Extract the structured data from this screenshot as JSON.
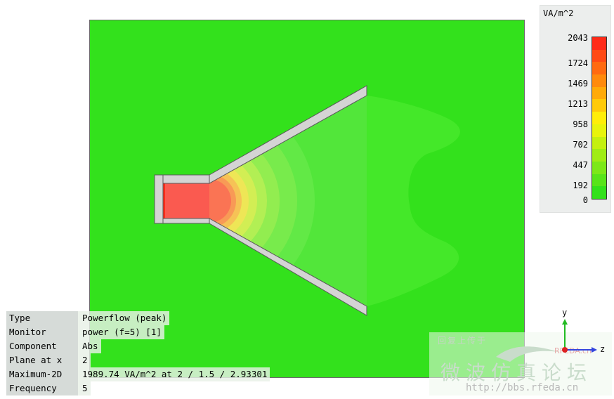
{
  "legend": {
    "unit": "VA/m^2",
    "ticks": [
      "2043",
      "1724",
      "1469",
      "1213",
      "958",
      "702",
      "447",
      "192",
      "0"
    ],
    "colors": [
      "#ff2a18",
      "#ff4a14",
      "#ff6a10",
      "#ff8a0c",
      "#ffaa08",
      "#ffca08",
      "#ffee08",
      "#e8f40c",
      "#c4f010",
      "#a0ec14",
      "#7ce818",
      "#58e41a",
      "#33e11c"
    ]
  },
  "info": [
    {
      "key": "Type",
      "value": "Powerflow (peak)"
    },
    {
      "key": "Monitor",
      "value": "power (f=5) [1]"
    },
    {
      "key": "Component",
      "value": "Abs"
    },
    {
      "key": "Plane at x",
      "value": "2"
    },
    {
      "key": "Maximum-2D",
      "value": "1989.74 VA/m^2 at 2 / 1.5 / 2.93301"
    },
    {
      "key": "Frequency",
      "value": "5"
    }
  ],
  "axes": {
    "y_label": "y",
    "z_label": "z"
  },
  "watermark": {
    "small_text": "回复上传于",
    "brand": "RFEDA.cn",
    "chinese": "微波仿真论坛",
    "url": "http://bbs.rfeda.cn"
  },
  "colors": {
    "background_field": "#33e11c",
    "horn_wall": "#d4d4d4",
    "hot": "#fa5a50"
  }
}
